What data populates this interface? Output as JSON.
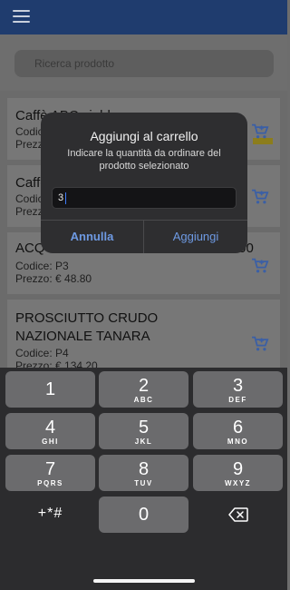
{
  "search": {
    "placeholder": "Ricerca prodotto"
  },
  "products": [
    {
      "name": "Caffè ABC cialde",
      "code": "Codic",
      "price": "Prezz"
    },
    {
      "name": "Caffè",
      "code": "Codic",
      "price": "Prezz"
    },
    {
      "name": "ACQUA ORIGINAL NATURALE CL 100",
      "code": "Codice: P3",
      "price": "Prezzo: € 48.80"
    },
    {
      "name_line1": "PROSCIUTTO CRUDO",
      "name_line2": "NAZIONALE TANARA",
      "code": "Codice: P4",
      "price": "Prezzo: € 134.20"
    }
  ],
  "dialog": {
    "title": "Aggiungi al carrello",
    "message": "Indicare la quantità da ordinare del prodotto selezionato",
    "input_value": "3",
    "cancel_label": "Annulla",
    "confirm_label": "Aggiungi"
  },
  "keypad": {
    "keys": [
      {
        "n": "1",
        "l": ""
      },
      {
        "n": "2",
        "l": "ABC"
      },
      {
        "n": "3",
        "l": "DEF"
      },
      {
        "n": "4",
        "l": "GHI"
      },
      {
        "n": "5",
        "l": "JKL"
      },
      {
        "n": "6",
        "l": "MNO"
      },
      {
        "n": "7",
        "l": "PQRS"
      },
      {
        "n": "8",
        "l": "TUV"
      },
      {
        "n": "9",
        "l": "WXYZ"
      },
      {
        "n": "0",
        "l": ""
      }
    ],
    "symbols_label": "+*#",
    "delete_icon": "backspace-icon"
  },
  "colors": {
    "topbar": "#1f3c6e",
    "dialog_button": "#6e9ae3",
    "cart_icon": "#3a5fa6"
  }
}
